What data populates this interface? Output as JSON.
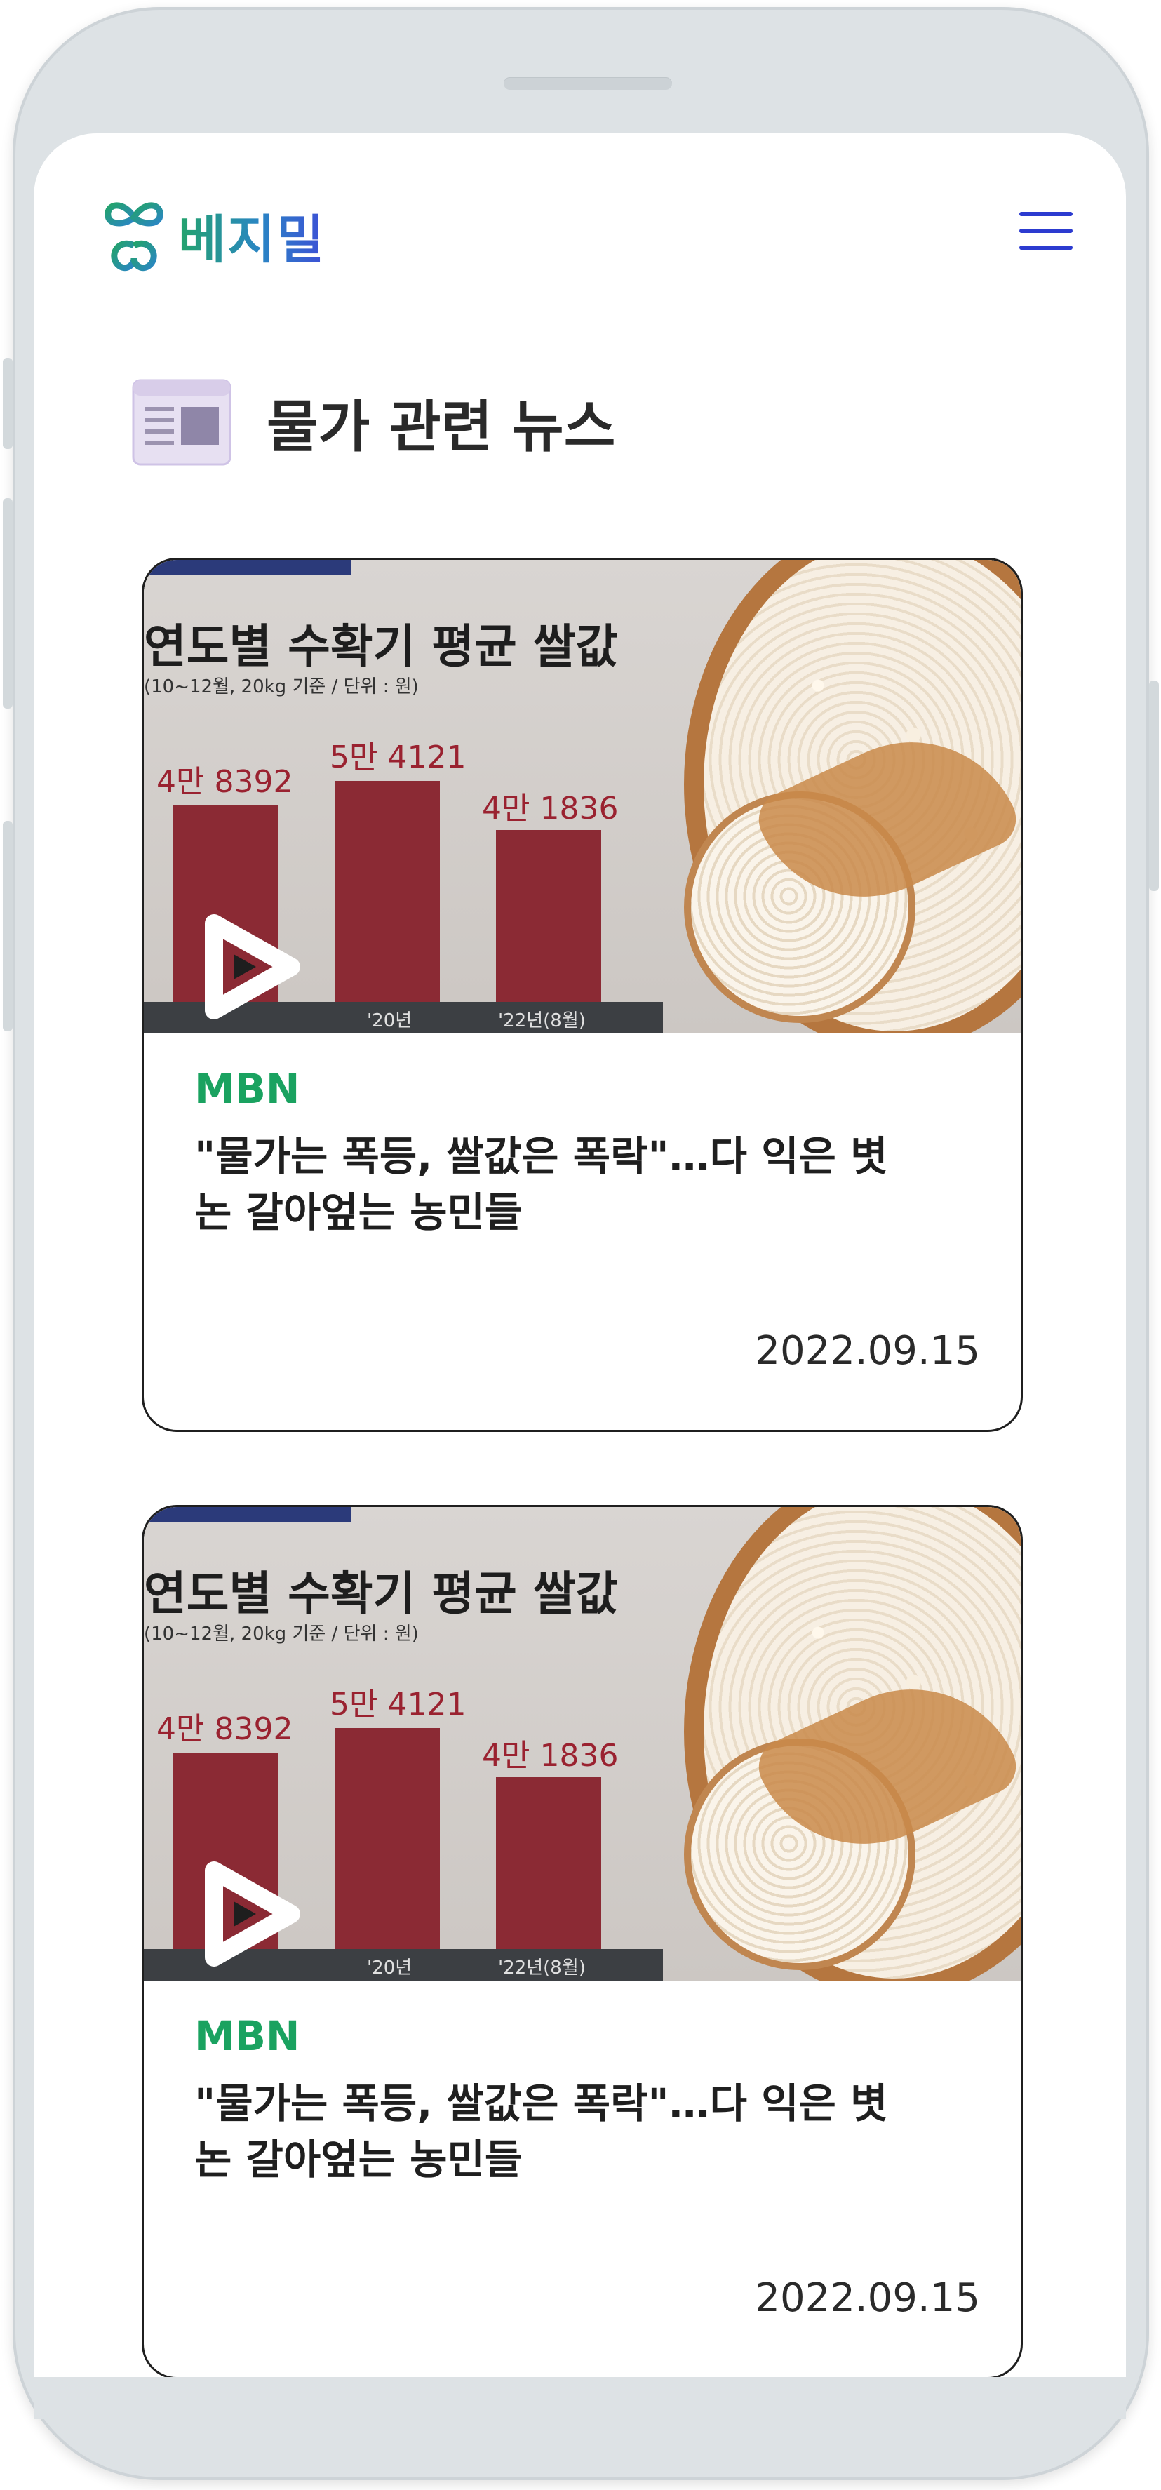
{
  "header": {
    "brand": "베지밀"
  },
  "section": {
    "title": "물가 관련 뉴스"
  },
  "news": [
    {
      "thumbnail": {
        "title": "연도별 수확기 평균 쌀값",
        "subtitle": "(10~12월, 20kg 기준 / 단위 : 원)",
        "bar_labels": [
          "4만 8392",
          "5만 4121",
          "4만 1836"
        ],
        "bar_values": [
          48392,
          54121,
          41836
        ],
        "axis_labels": [
          "'20년",
          "'22년(8월)"
        ]
      },
      "source": "MBN",
      "headline": "\"물가는 폭등, 쌀값은 폭락\"…다 익은 볏논 갈아엎는 농민들",
      "date": "2022.09.15"
    },
    {
      "thumbnail": {
        "title": "연도별 수확기 평균 쌀값",
        "subtitle": "(10~12월, 20kg 기준 / 단위 : 원)",
        "bar_labels": [
          "4만 8392",
          "5만 4121",
          "4만 1836"
        ],
        "bar_values": [
          48392,
          54121,
          41836
        ],
        "axis_labels": [
          "'20년",
          "'22년(8월)"
        ]
      },
      "source": "MBN",
      "headline": "\"물가는 폭등, 쌀값은 폭락\"…다 익은 볏논 갈아엎는 농민들",
      "date": "2022.09.15"
    }
  ],
  "colors": {
    "source_green": "#1aa260",
    "menu_blue": "#2c3bd0",
    "bar_red": "#8b2a34"
  },
  "icons": {
    "logo": "sprout-logo-icon",
    "menu": "hamburger-menu-icon",
    "section": "newspaper-icon",
    "play": "play-icon"
  }
}
